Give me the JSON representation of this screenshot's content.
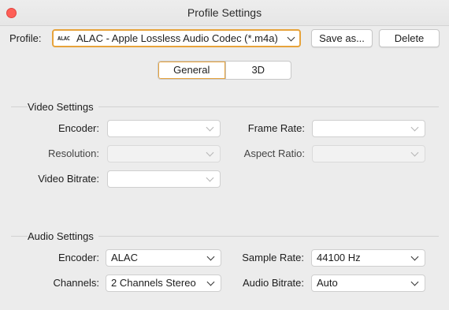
{
  "window": {
    "title": "Profile Settings"
  },
  "profile": {
    "label": "Profile:",
    "badge": "ALAC",
    "value": "ALAC - Apple Lossless Audio Codec (*.m4a)",
    "save_as_label": "Save as...",
    "delete_label": "Delete"
  },
  "tabs": [
    {
      "label": "General",
      "active": true
    },
    {
      "label": "3D",
      "active": false
    }
  ],
  "video": {
    "title": "Video Settings",
    "encoder_label": "Encoder:",
    "encoder_value": "",
    "frame_rate_label": "Frame Rate:",
    "frame_rate_value": "",
    "resolution_label": "Resolution:",
    "resolution_value": "",
    "aspect_ratio_label": "Aspect Ratio:",
    "aspect_ratio_value": "",
    "bitrate_label": "Video Bitrate:",
    "bitrate_value": ""
  },
  "audio": {
    "title": "Audio Settings",
    "encoder_label": "Encoder:",
    "encoder_value": "ALAC",
    "sample_rate_label": "Sample Rate:",
    "sample_rate_value": "44100 Hz",
    "channels_label": "Channels:",
    "channels_value": "2 Channels Stereo",
    "bitrate_label": "Audio Bitrate:",
    "bitrate_value": "Auto"
  },
  "colors": {
    "accent": "#e7a33b",
    "close": "#fe5f57"
  }
}
